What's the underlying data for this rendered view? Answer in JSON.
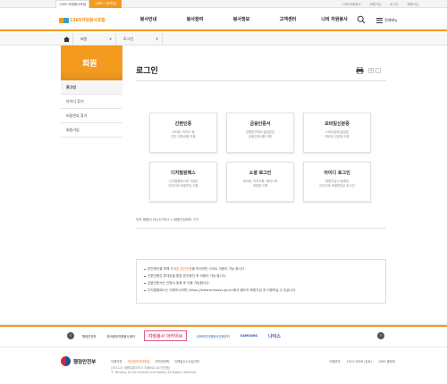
{
  "topbar": {
    "tabs": [
      "1365 자원봉사포털",
      "1365 기부포털"
    ],
    "utils": [
      "1365자원봉사",
      "회원가입",
      "로그인",
      "회원가입"
    ]
  },
  "header": {
    "logo": "1365자원봉사포털",
    "menu": [
      "봉사안내",
      "봉사참여",
      "봉사정보",
      "고객센터",
      "나의 자원봉사"
    ],
    "allmenu": "전체메뉴",
    "icons": {
      "search": "search-icon",
      "menu": "hamburger-icon",
      "home": "home-icon"
    }
  },
  "breadcrumb": {
    "items": [
      "회원",
      "로그인"
    ]
  },
  "lnb": {
    "title": "회원",
    "items": [
      "로그인",
      "아이디 찾기",
      "비밀번호 찾기",
      "회원가입"
    ]
  },
  "main": {
    "title": "로그인",
    "zoom": [
      "+",
      "-"
    ],
    "cards": [
      {
        "title": "간편인증",
        "desc": [
          "네이버, 카카오 등",
          "민간 인증서를 이용"
        ]
      },
      {
        "title": "금융인증서",
        "desc": [
          "은행창구에서 발급받은",
          "금융인증서를 이용"
        ]
      },
      {
        "title": "모바일신분증",
        "desc": [
          "스마트폰에 발급된",
          "모바일 신분증 이용"
        ]
      },
      {
        "title": "디지털원패스",
        "desc": [
          "디지털원패스에 가입한",
          "아이디와 비밀번호 이용"
        ]
      },
      {
        "title": "소셜 로그인",
        "desc": [
          "네이버, 카카오톡, 페이스북",
          "계정을 이용"
        ]
      },
      {
        "title": "아이디 로그인",
        "desc": [
          "회원가입시 등록한",
          "아이디와 비밀번호로 로그인"
        ]
      }
    ],
    "find_help": "아직 회원이 아니신가요?  > 회원가입하러 가기",
    "notices": [
      {
        "pre": "본인확인을 위해 ",
        "em": "휴대폰 본인인증",
        "post": "을 하셔야만 사이트 이용이 가능 합니다."
      },
      {
        "pre": "간편인증은 휴대폰을 통한 본인확인 후 이용이 가능 합니다.",
        "em": "",
        "post": ""
      },
      {
        "pre": "금융인증서는 인증서 등록 후 이용 가능합니다.",
        "em": "",
        "post": ""
      },
      {
        "pre": "디지털원패스는 이용하시려면 (https://www.onepass.go.kr)에서 별도의 회원가입 후 이용하실 수 있습니다.",
        "em": "",
        "post": ""
      }
    ]
  },
  "partners": {
    "items": [
      "행정안전부",
      "한국중앙자원봉사센터",
      "자원봉사 아카이브",
      "사회복지자원봉사인증관리",
      "SAMSUNG",
      "나이스"
    ],
    "prev_icon": "chevron-left-icon",
    "next": "›"
  },
  "footer": {
    "org": "행정안전부",
    "links": [
      "이용약관",
      "개인정보처리방침",
      "저작권정책",
      "이메일주소수집거부"
    ],
    "address": [
      "(30112) 세종특별자치시 도움6로 42(어진동)",
      "© Ministry of the Interior and Safety. All Rights reserved."
    ],
    "right": [
      "이용문의",
      "1522-3658 (유료)",
      "1365 콜센터"
    ]
  },
  "colors": {
    "accent": "#f39a1f",
    "link": "#e8742b"
  }
}
